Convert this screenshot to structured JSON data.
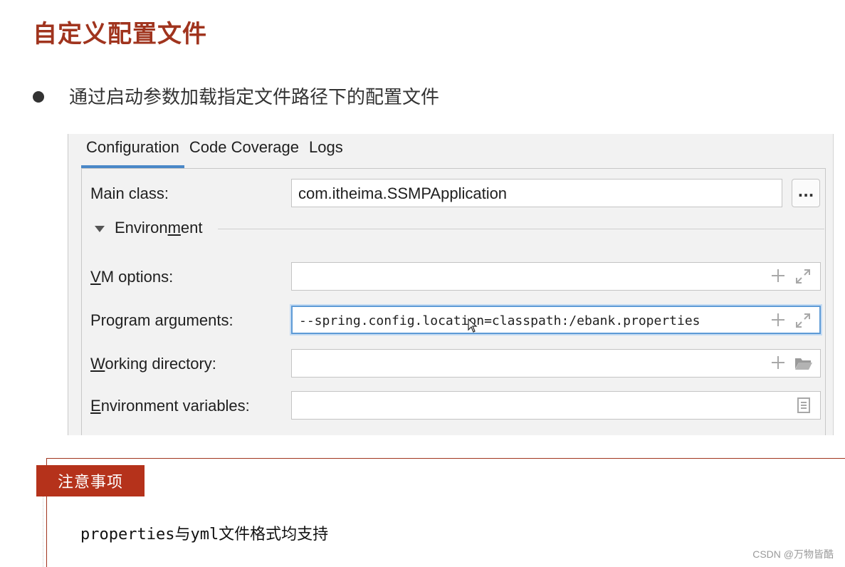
{
  "slide": {
    "title": "自定义配置文件",
    "bullet": "通过启动参数加载指定文件路径下的配置文件"
  },
  "tabs": [
    {
      "label": "Configuration",
      "active": true
    },
    {
      "label": "Code Coverage",
      "active": false
    },
    {
      "label": "Logs",
      "active": false
    }
  ],
  "form": {
    "main_class": {
      "label": "Main class:",
      "value": "com.itheima.SSMPApplication",
      "browse_label": "..."
    },
    "environment": {
      "prefix": "Environ",
      "mnemonic": "m",
      "suffix": "ent"
    },
    "vm_options": {
      "mnemonic": "V",
      "label_rest": "M options:",
      "value": ""
    },
    "program_arguments": {
      "label_pre": "Program ar",
      "mnemonic": "g",
      "label_post": "uments:",
      "value": "--spring.config.location=classpath:/ebank.properties"
    },
    "working_directory": {
      "mnemonic": "W",
      "label_rest": "orking directory:",
      "value": ""
    },
    "environment_variables": {
      "mnemonic": "E",
      "label_rest": "nvironment variables:",
      "value": ""
    }
  },
  "notes": {
    "badge": "注意事项",
    "text": "properties与yml文件格式均支持"
  },
  "watermark": "CSDN @万物皆酷",
  "colors": {
    "title_red": "#a0341e",
    "badge_red": "#b5321b",
    "tab_accent": "#4a88c7",
    "focus_border": "#5e9bd6"
  }
}
